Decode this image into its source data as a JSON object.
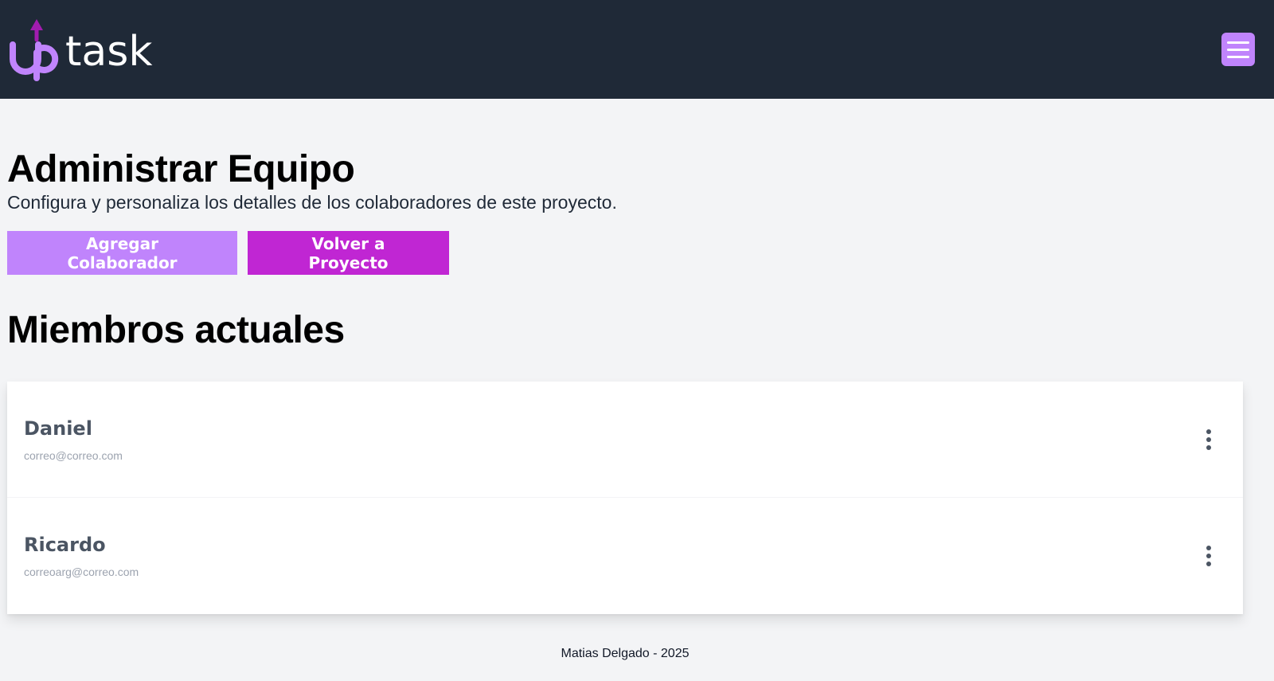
{
  "header": {
    "logo_alt": "uptask",
    "menu_icon": "hamburger-menu-icon"
  },
  "page": {
    "title": "Administrar Equipo",
    "subtitle": "Configura y personaliza los detalles de los colaboradores de este proyecto."
  },
  "actions": {
    "add_label": "Agregar Colaborador",
    "back_label": "Volver a Proyecto"
  },
  "members": {
    "title": "Miembros actuales",
    "items": [
      {
        "name": "Daniel",
        "email": "correo@correo.com"
      },
      {
        "name": "Ricardo",
        "email": "correoarg@correo.com"
      }
    ]
  },
  "footer": {
    "text": "Matias Delgado - 2025"
  },
  "colors": {
    "header_bg": "#1f2937",
    "accent_light": "#c084fc",
    "accent_strong": "#c026d3",
    "page_bg": "#f3f4f6"
  }
}
